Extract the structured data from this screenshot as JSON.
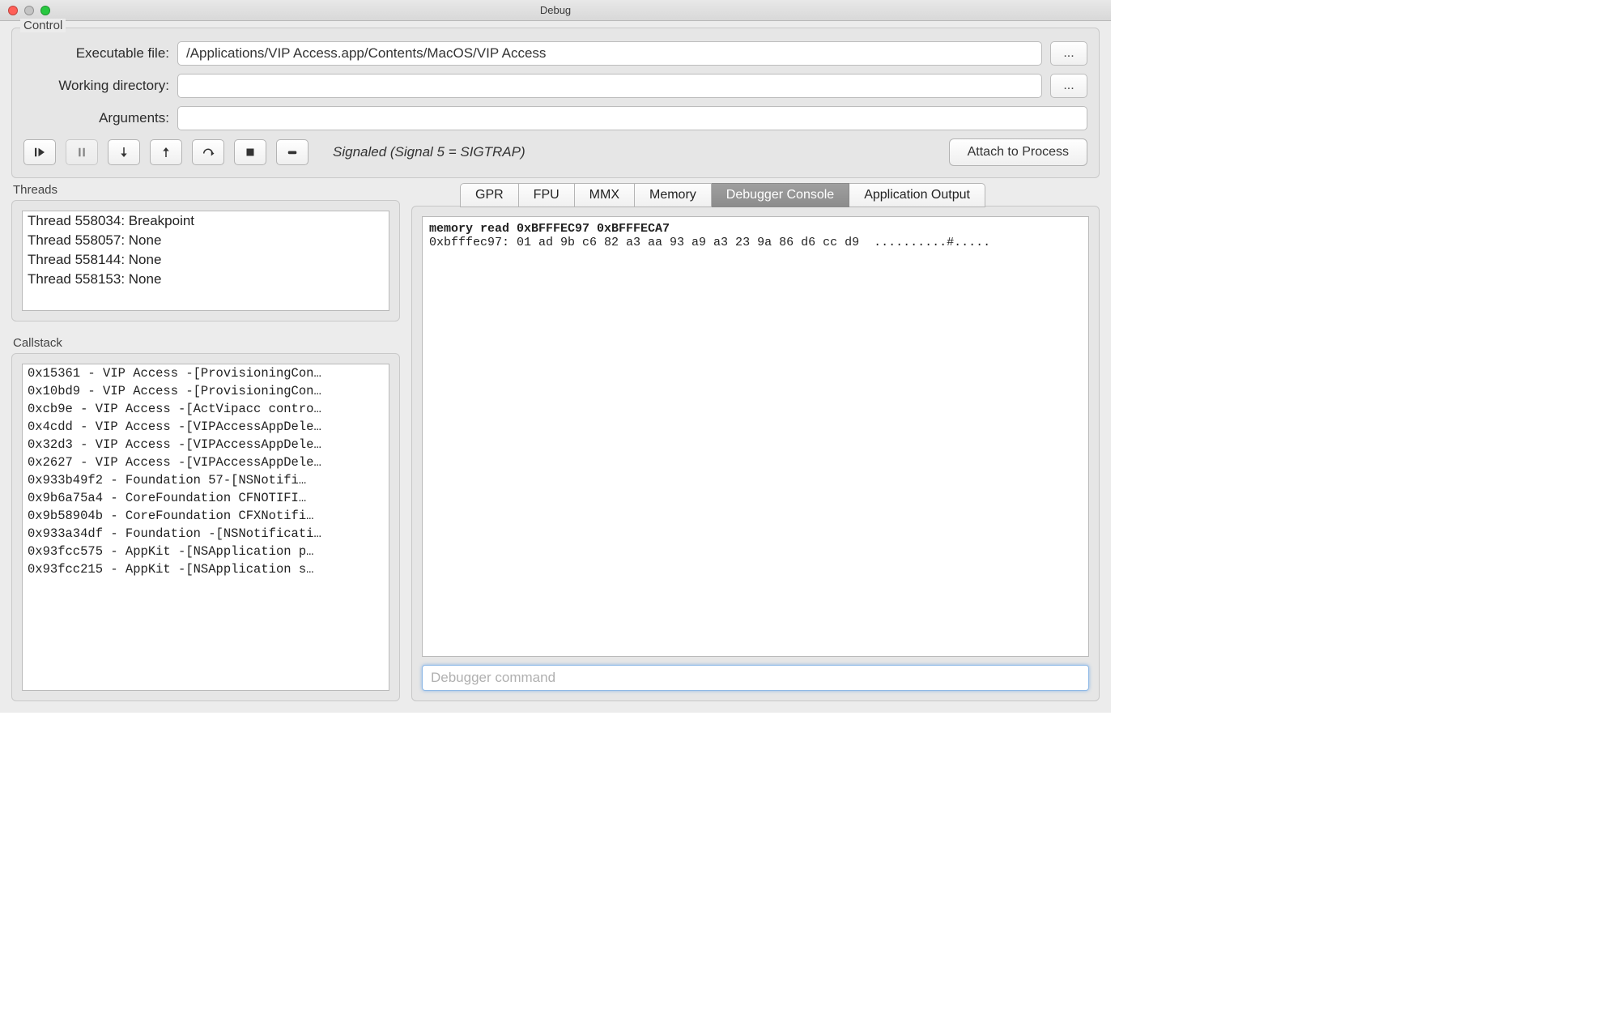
{
  "window": {
    "title": "Debug"
  },
  "control": {
    "legend": "Control",
    "exec_label": "Executable file:",
    "workdir_label": "Working directory:",
    "args_label": "Arguments:",
    "exec_value": "/Applications/VIP Access.app/Contents/MacOS/VIP Access",
    "workdir_value": "",
    "args_value": "",
    "browse_label": "...",
    "status": "Signaled (Signal 5 = SIGTRAP)",
    "attach_label": "Attach to Process"
  },
  "threads": {
    "label": "Threads",
    "items": [
      "Thread 558034: Breakpoint",
      "Thread 558057: None",
      "Thread 558144: None",
      "Thread 558153: None"
    ]
  },
  "callstack": {
    "label": "Callstack",
    "items": [
      "0x15361 - VIP Access -[ProvisioningCon…",
      "0x10bd9 - VIP Access -[ProvisioningCon…",
      "0xcb9e - VIP Access -[ActVipacc contro…",
      "0x4cdd - VIP Access -[VIPAccessAppDele…",
      "0x32d3 - VIP Access -[VIPAccessAppDele…",
      "0x2627 - VIP Access -[VIPAccessAppDele…",
      "0x933b49f2 - Foundation   57-[NSNotifi…",
      "0x9b6a75a4 - CoreFoundation   CFNOTIFI…",
      "0x9b58904b - CoreFoundation  CFXNotifi…",
      "0x933a34df - Foundation  -[NSNotificati…",
      "0x93fcc575 - AppKit -[NSApplication  p…",
      "0x93fcc215 - AppKit -[NSApplication  s…"
    ]
  },
  "tabs": {
    "gpr": "GPR",
    "fpu": "FPU",
    "mmx": "MMX",
    "memory": "Memory",
    "console": "Debugger Console",
    "appout": "Application Output"
  },
  "console": {
    "command": "memory read 0xBFFFEC97 0xBFFFECA7",
    "output": "0xbfffec97: 01 ad 9b c6 82 a3 aa 93 a9 a3 23 9a 86 d6 cc d9  ..........#.....",
    "input_placeholder": "Debugger command"
  }
}
